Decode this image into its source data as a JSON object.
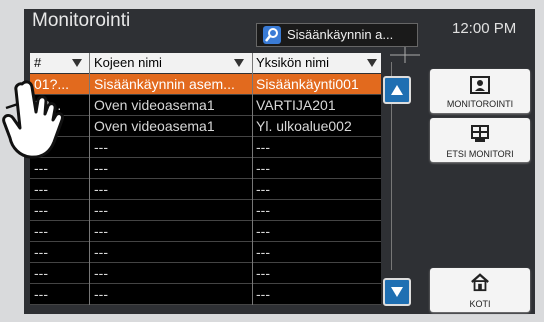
{
  "header": {
    "title": "Monitorointi",
    "search_text": "Sisäänkäynnin a...",
    "time": "12:00 PM"
  },
  "table": {
    "columns": [
      "#",
      "Kojeen nimi",
      "Yksikön nimi"
    ],
    "rows": [
      {
        "num": "01?...",
        "device": "Sisäänkäynnin asem...",
        "unit": "Sisäänkäynti001",
        "selected": true
      },
      {
        "num": "?2...",
        "device": "Oven videoasema1",
        "unit": "VARTIJA201",
        "selected": false
      },
      {
        "num": "0...",
        "device": "Oven videoasema1",
        "unit": "Yl. ulkoalue002",
        "selected": false
      },
      {
        "num": "---",
        "device": "---",
        "unit": "---",
        "selected": false
      },
      {
        "num": "---",
        "device": "---",
        "unit": "---",
        "selected": false
      },
      {
        "num": "---",
        "device": "---",
        "unit": "---",
        "selected": false
      },
      {
        "num": "---",
        "device": "---",
        "unit": "---",
        "selected": false
      },
      {
        "num": "---",
        "device": "---",
        "unit": "---",
        "selected": false
      },
      {
        "num": "---",
        "device": "---",
        "unit": "---",
        "selected": false
      },
      {
        "num": "---",
        "device": "---",
        "unit": "---",
        "selected": false
      },
      {
        "num": "---",
        "device": "---",
        "unit": "---",
        "selected": false
      }
    ]
  },
  "buttons": {
    "monitor": "MONITOROINTI",
    "search_monitor": "ETSI MONITORI",
    "home": "KOTI"
  },
  "colors": {
    "selected_row": "#e26a1e",
    "scroll_button": "#1f6fb2",
    "panel": "#2e3034"
  }
}
